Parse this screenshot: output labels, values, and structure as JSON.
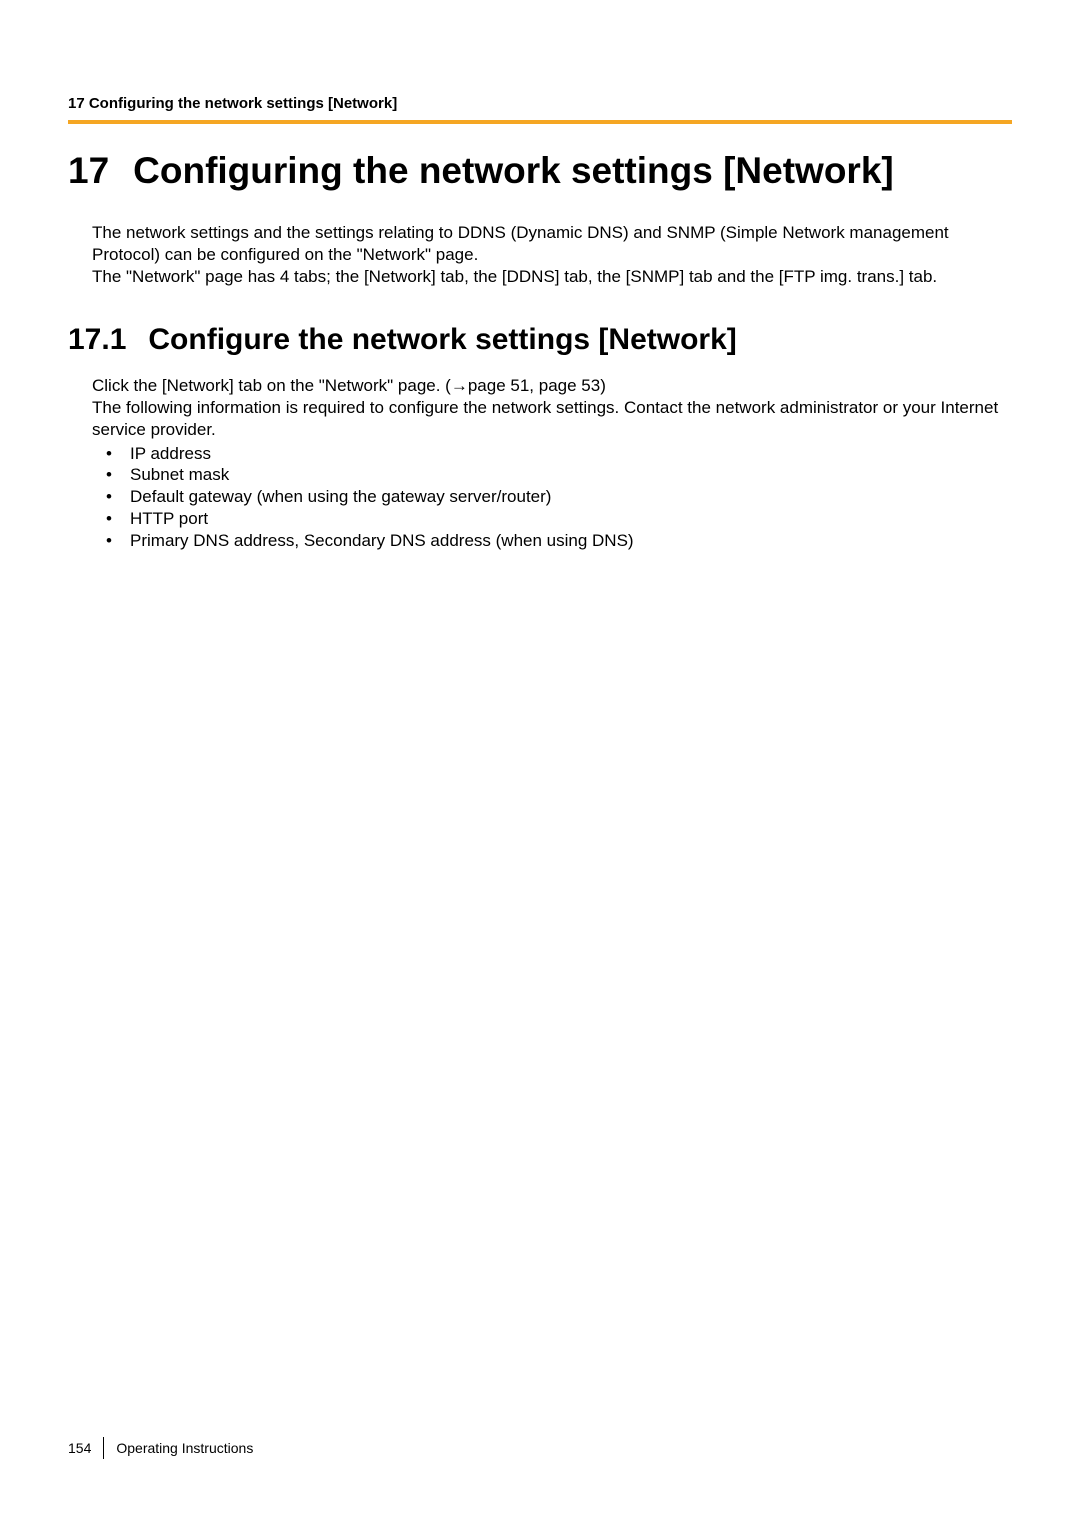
{
  "header": {
    "running_head": "17 Configuring the network settings [Network]"
  },
  "chapter": {
    "number": "17",
    "title": "Configuring the network settings [Network]",
    "intro": "The network settings and the settings relating to DDNS (Dynamic DNS) and SNMP (Simple Network management Protocol) can be configured on the \"Network\" page.\nThe \"Network\" page has 4 tabs; the [Network] tab, the [DDNS] tab, the [SNMP] tab and the [FTP img. trans.] tab."
  },
  "section": {
    "number": "17.1",
    "title": "Configure the network settings [Network]",
    "line1_prefix": "Click the [Network] tab on the \"Network\" page. (",
    "line1_arrow": "→",
    "line1_suffix": "page 51, page 53)",
    "line2": "The following information is required to configure the network settings. Contact the network administrator or your Internet service provider.",
    "bullets": [
      "IP address",
      "Subnet mask",
      "Default gateway (when using the gateway server/router)",
      "HTTP port",
      "Primary DNS address, Secondary DNS address (when using DNS)"
    ]
  },
  "footer": {
    "page_number": "154",
    "doc_title": "Operating Instructions"
  }
}
